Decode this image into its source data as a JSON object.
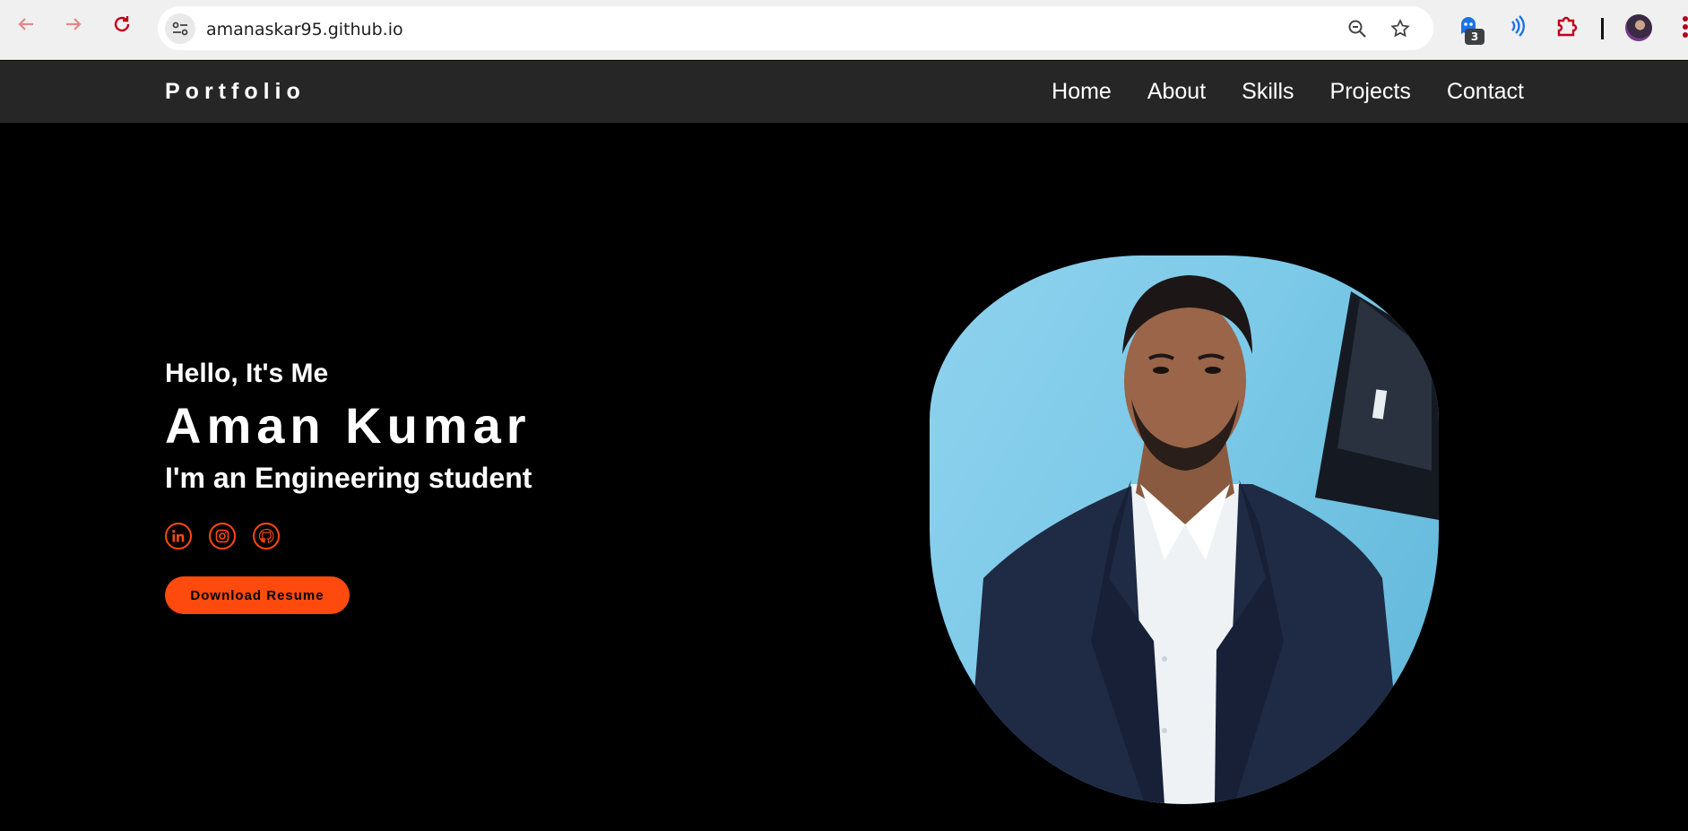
{
  "browser": {
    "url": "amanaskar95.github.io",
    "extension_badge": "3",
    "accent_color": "#b00020"
  },
  "site": {
    "logo": "Portfolio",
    "nav": [
      "Home",
      "About",
      "Skills",
      "Projects",
      "Contact"
    ],
    "background": "#000000",
    "header_background": "#262626"
  },
  "hero": {
    "greeting": "Hello, It's Me",
    "name": "Aman Kumar",
    "role": "I'm an Engineering student",
    "socials": [
      "linkedin-icon",
      "instagram-icon",
      "github-icon"
    ],
    "button_label": "Download Resume",
    "accent_color": "#ff4a0d",
    "portrait": "portrait-photo"
  }
}
